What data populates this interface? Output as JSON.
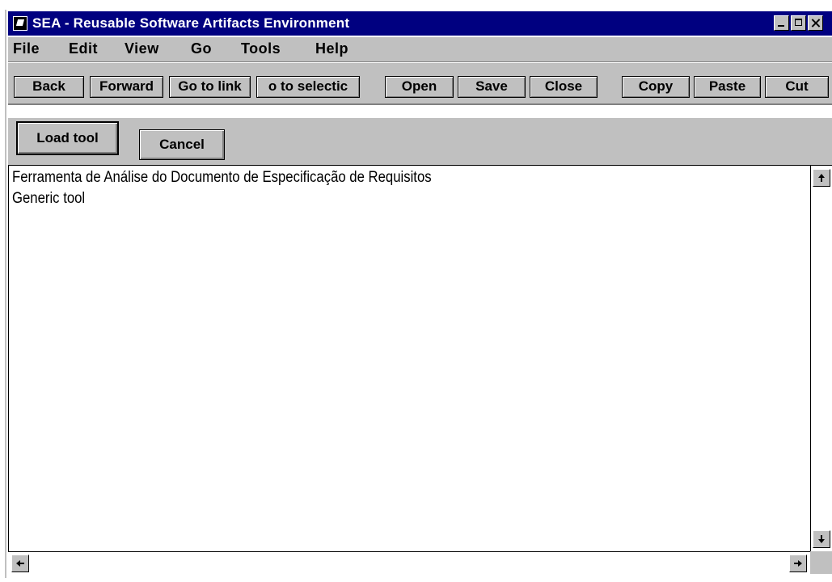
{
  "window": {
    "title": "SEA - Reusable Software Artifacts Environment"
  },
  "menu": {
    "items": [
      "File",
      "Edit",
      "View",
      "Go",
      "Tools",
      "Help"
    ]
  },
  "toolbar": {
    "buttons": [
      "Back",
      "Forward",
      "Go to link",
      "o to selectic",
      "Open",
      "Save",
      "Close",
      "Copy",
      "Paste",
      "Cut"
    ]
  },
  "actions": {
    "load_tool": "Load tool",
    "cancel": "Cancel"
  },
  "content": {
    "lines": [
      "Ferramenta de Análise do Documento de Especificação de Requisitos",
      "Generic tool"
    ]
  },
  "colors": {
    "titlebar": "#000080",
    "chrome": "#c0c0c0",
    "content": "#ffffff"
  }
}
